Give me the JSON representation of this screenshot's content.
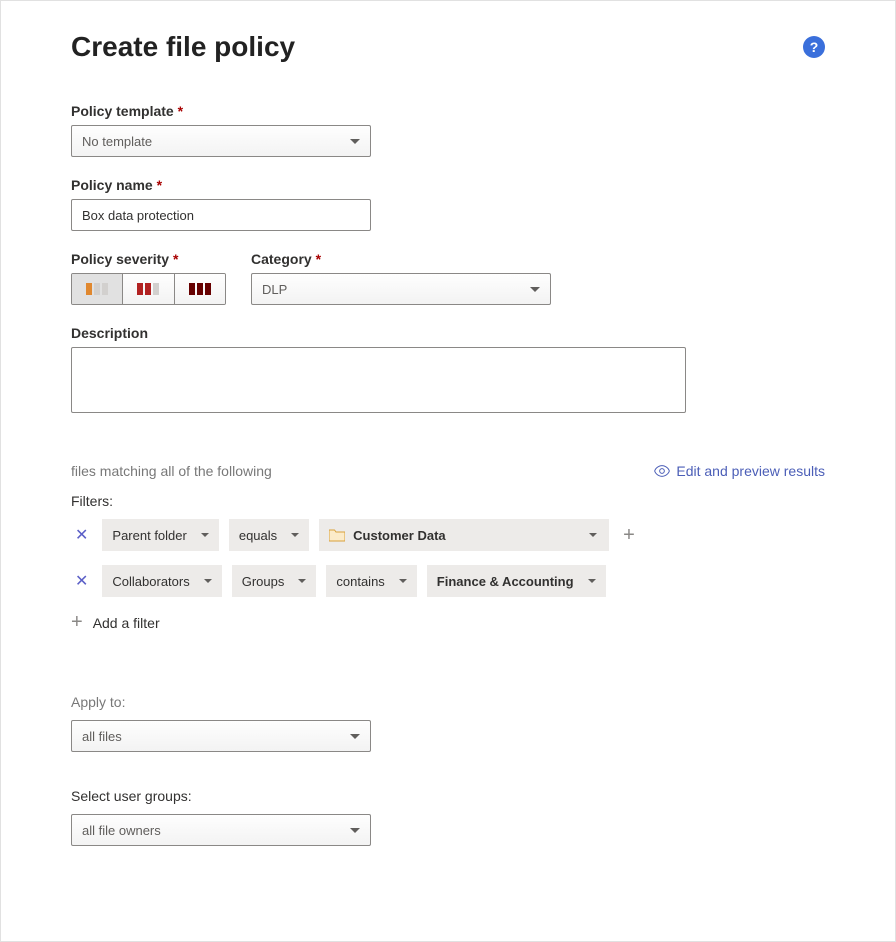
{
  "title": "Create file policy",
  "labels": {
    "policy_template": "Policy template",
    "policy_name": "Policy name",
    "policy_severity": "Policy severity",
    "category": "Category",
    "description": "Description",
    "files_matching": "files matching all of the following",
    "edit_preview": "Edit and preview results",
    "filters": "Filters:",
    "add_filter": "Add a filter",
    "apply_to": "Apply to:",
    "select_user_groups": "Select user groups:",
    "star": "*"
  },
  "template": {
    "value": "No template"
  },
  "policy_name": "Box data protection",
  "category": {
    "value": "DLP"
  },
  "filters": [
    {
      "field": "Parent folder",
      "op": "equals",
      "value": "Customer Data",
      "value_type": "folder"
    },
    {
      "field": "Collaborators",
      "subfield": "Groups",
      "op": "contains",
      "value": "Finance & Accounting"
    }
  ],
  "apply_to": "all files",
  "user_groups": "all file owners"
}
